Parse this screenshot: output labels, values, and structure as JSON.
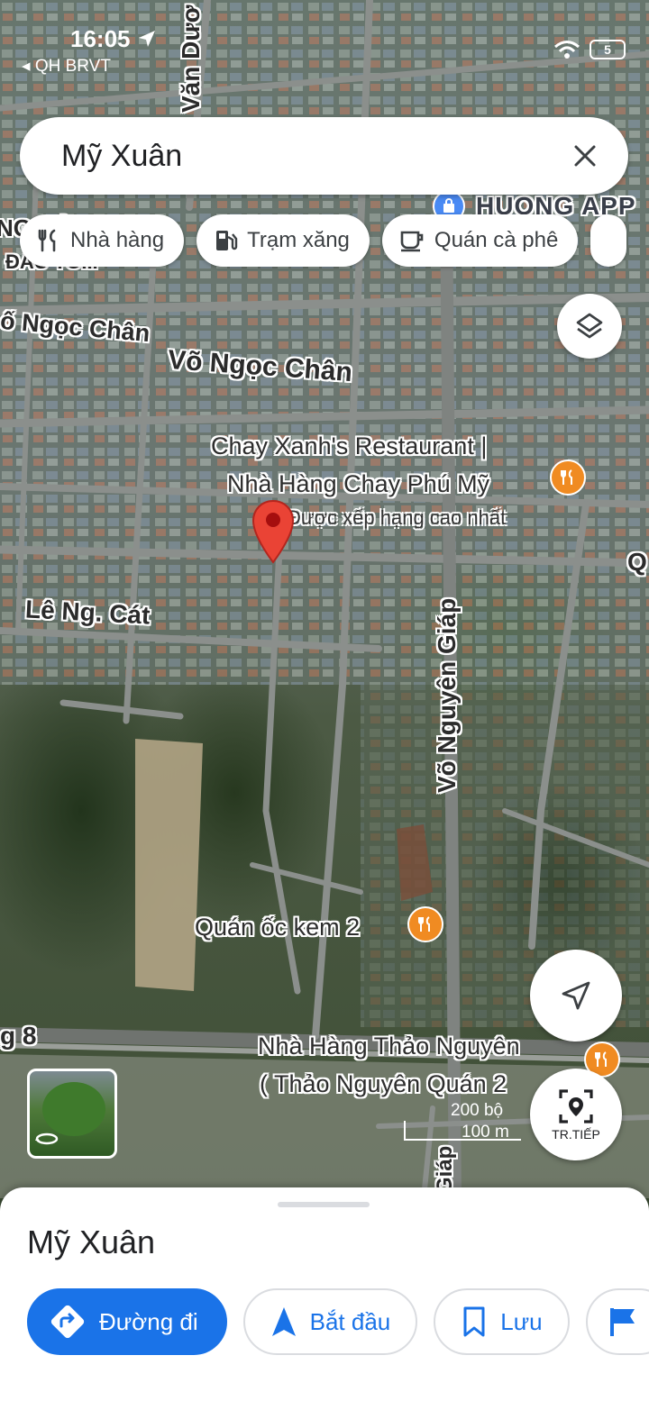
{
  "status_bar": {
    "time": "16:05",
    "back_label": "◂ QH BRVT",
    "battery": "5"
  },
  "search": {
    "query": "Mỹ Xuân"
  },
  "chips": [
    {
      "label": "Nhà hàng",
      "icon": "restaurant-icon"
    },
    {
      "label": "Trạm xăng",
      "icon": "gas-station-icon"
    },
    {
      "label": "Quán cà phê",
      "icon": "coffee-icon"
    }
  ],
  "map": {
    "streets": {
      "van_duong": "Văn Dươ",
      "vo_ngoc_chan_1": "ố Ngọc Chân",
      "vo_ngoc_chan_2": "Võ Ngọc Chân",
      "le_ng_cat": "Lê Ng. Cát",
      "vo_nguyen_giap": "Võ Nguyên Giáp",
      "vo_nguyen_giap_2": "Giáp",
      "road_8": "g 8",
      "truncated_left": "NG CẢ",
      "truncated_left_2": "ĐẤU TỐ...",
      "edge_right": "Q"
    },
    "pois": {
      "huong_app": "HUONG APP",
      "chay_xanh_line1": "Chay Xanh's Restaurant |",
      "chay_xanh_line2": "Nhà Hàng Chay Phú Mỹ",
      "chay_xanh_rating": "Được xếp hạng cao nhất",
      "quan_oc": "Quán ốc kem 2",
      "thao_nguyen_line1": "Nhà Hàng Thảo Nguyên",
      "thao_nguyen_line2": "( Thảo Nguyên Quán 2"
    },
    "scale": {
      "top": "200 bộ",
      "bottom": "100 m"
    },
    "next_button_label": "TR.TIẾP"
  },
  "sheet": {
    "title": "Mỹ Xuân",
    "actions": [
      {
        "label": "Đường đi",
        "icon": "directions-icon"
      },
      {
        "label": "Bắt đầu",
        "icon": "navigation-arrow-icon"
      },
      {
        "label": "Lưu",
        "icon": "bookmark-icon"
      },
      {
        "label": "",
        "icon": "flag-icon"
      }
    ]
  },
  "colors": {
    "accent": "#1a73e8",
    "pin": "#ea4335",
    "food_pin": "#f08b22"
  }
}
